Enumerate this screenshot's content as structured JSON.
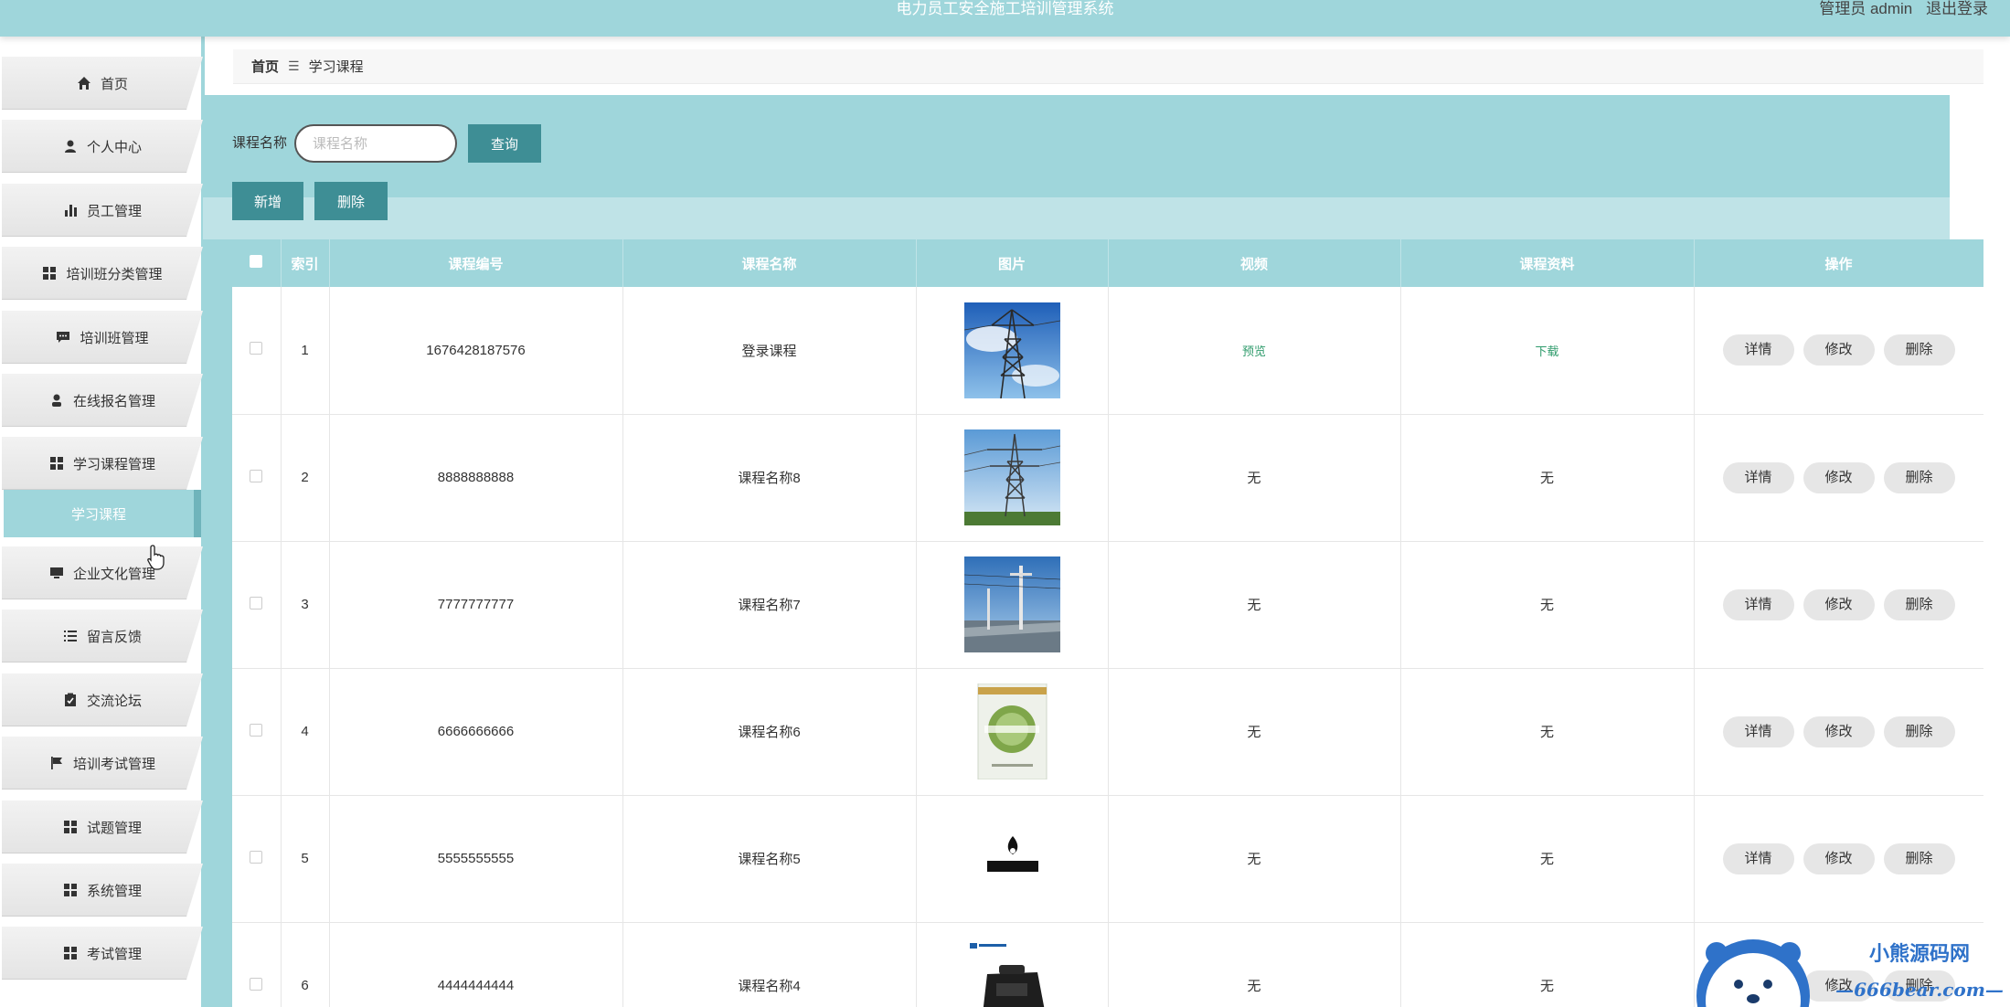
{
  "header": {
    "app_title": "电力员工安全施工培训管理系统",
    "user_label": "管理员 admin",
    "logout_label": "退出登录"
  },
  "sidebar": {
    "items": [
      {
        "label": "首页",
        "icon": "home-icon"
      },
      {
        "label": "个人中心",
        "icon": "user-icon"
      },
      {
        "label": "员工管理",
        "icon": "bar-chart-icon"
      },
      {
        "label": "培训班分类管理",
        "icon": "grid-icon"
      },
      {
        "label": "培训班管理",
        "icon": "comment-icon"
      },
      {
        "label": "在线报名管理",
        "icon": "person-icon"
      },
      {
        "label": "学习课程管理",
        "icon": "grid-icon"
      },
      {
        "label": "企业文化管理",
        "icon": "monitor-icon"
      },
      {
        "label": "留言反馈",
        "icon": "list-icon"
      },
      {
        "label": "交流论坛",
        "icon": "clipboard-icon"
      },
      {
        "label": "培训考试管理",
        "icon": "flag-icon"
      },
      {
        "label": "试题管理",
        "icon": "grid-icon"
      },
      {
        "label": "系统管理",
        "icon": "grid-icon"
      },
      {
        "label": "考试管理",
        "icon": "grid-icon"
      }
    ],
    "active_sub": "学习课程"
  },
  "breadcrumb": {
    "home": "首页",
    "current": "学习课程"
  },
  "search": {
    "label": "课程名称",
    "placeholder": "课程名称",
    "query_button": "查询"
  },
  "actions": {
    "add_button": "新增",
    "delete_button": "删除"
  },
  "table": {
    "headers": [
      "索引",
      "课程编号",
      "课程名称",
      "图片",
      "视频",
      "课程资料",
      "操作"
    ],
    "op_labels": {
      "detail": "详情",
      "edit": "修改",
      "delete": "删除"
    },
    "rows": [
      {
        "index": "1",
        "code": "1676428187576",
        "name": "登录课程",
        "video": "预览",
        "material": "下载"
      },
      {
        "index": "2",
        "code": "8888888888",
        "name": "课程名称8",
        "video": "无",
        "material": "无"
      },
      {
        "index": "3",
        "code": "7777777777",
        "name": "课程名称7",
        "video": "无",
        "material": "无"
      },
      {
        "index": "4",
        "code": "6666666666",
        "name": "课程名称6",
        "video": "无",
        "material": "无"
      },
      {
        "index": "5",
        "code": "5555555555",
        "name": "课程名称5",
        "video": "无",
        "material": "无"
      },
      {
        "index": "6",
        "code": "4444444444",
        "name": "课程名称4",
        "video": "无",
        "material": "无"
      }
    ]
  },
  "watermark": {
    "line1": "小熊源码网",
    "line2": "—666bear.com—"
  },
  "colors": {
    "primary": "#9fd6db",
    "button": "#3e8e95",
    "link": "#2e9b6b"
  }
}
